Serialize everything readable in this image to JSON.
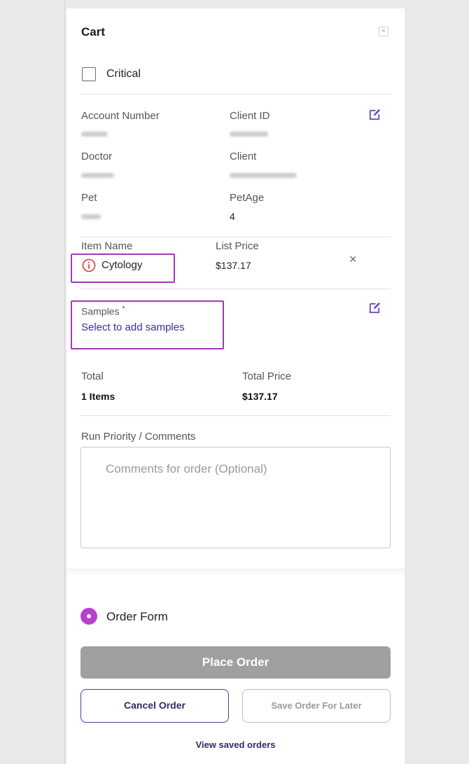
{
  "cart": {
    "title": "Cart",
    "close_symbol": "×",
    "critical_label": "Critical",
    "critical_checked": false
  },
  "account": {
    "account_number_label": "Account Number",
    "client_id_label": "Client ID",
    "doctor_label": "Doctor",
    "client_label": "Client",
    "pet_label": "Pet",
    "pet_age_label": "PetAge",
    "pet_age_value": "4"
  },
  "item": {
    "name_label": "Item Name",
    "list_price_label": "List Price",
    "name": "Cytology",
    "price": "$137.17",
    "remove_symbol": "×"
  },
  "samples": {
    "label": "Samples",
    "required_mark": "*",
    "link": "Select to add samples"
  },
  "totals": {
    "total_label": "Total",
    "total_price_label": "Total Price",
    "items": "1 Items",
    "price": "$137.17"
  },
  "comments": {
    "label": "Run Priority / Comments",
    "placeholder": "Comments for order (Optional)"
  },
  "footer": {
    "order_form_label": "Order Form",
    "place_order": "Place Order",
    "cancel_order": "Cancel Order",
    "save_for_later": "Save Order For Later",
    "view_saved": "View saved orders"
  },
  "colors": {
    "accent": "#b63fcf",
    "primary_text": "#3a2fa0",
    "highlight_border": "#a03ab8",
    "disabled_button": "#a0a0a0"
  },
  "icons": [
    "close-icon",
    "checkbox-icon",
    "edit-icon",
    "info-icon",
    "remove-icon",
    "radio-icon"
  ]
}
